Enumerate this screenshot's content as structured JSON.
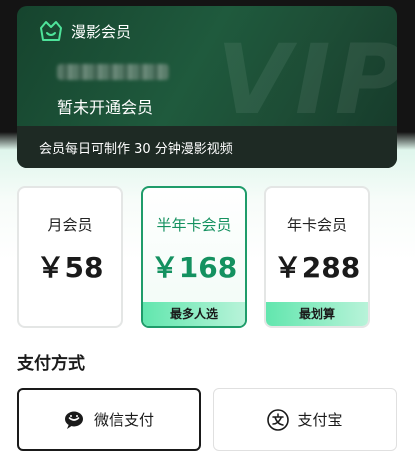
{
  "member_card": {
    "brand_label": "漫影会员",
    "status_text": "暂未开通会员",
    "benefit_text": "会员每日可制作 30 分钟漫影视频",
    "watermark_text": "VIP",
    "brand_icon": "crown-basket-icon",
    "accent_color": "#4ee39a"
  },
  "plans": [
    {
      "name": "月会员",
      "price": "￥58",
      "tag": ""
    },
    {
      "name": "半年卡会员",
      "price": "￥168",
      "tag": "最多人选",
      "selected": true
    },
    {
      "name": "年卡会员",
      "price": "￥288",
      "tag": "最划算"
    }
  ],
  "payment": {
    "title": "支付方式",
    "options": [
      {
        "label": "微信支付",
        "icon": "wechat-icon",
        "selected": true
      },
      {
        "label": "支付宝",
        "icon": "alipay-icon",
        "selected": false
      }
    ]
  },
  "colors": {
    "selected_plan": "#149160",
    "tag_gradient_start": "#62e6ae",
    "tag_gradient_end": "#b8f3d9",
    "card_dark": "#1f5a3d"
  }
}
